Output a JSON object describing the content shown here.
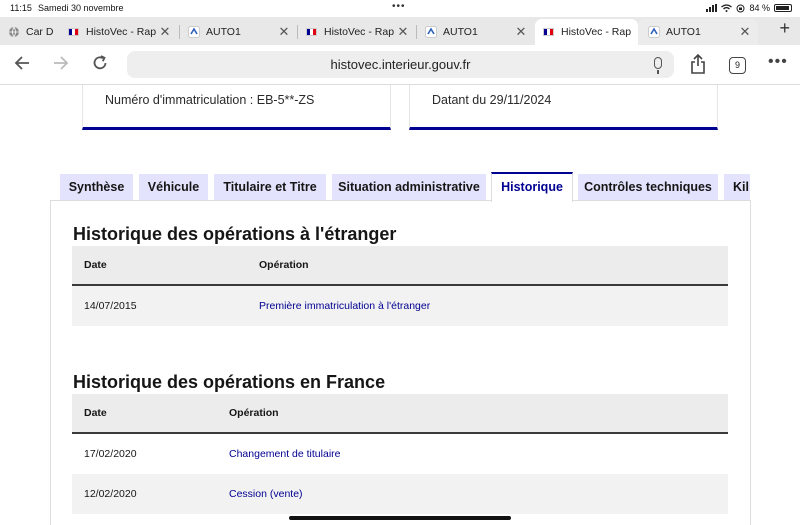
{
  "status": {
    "time": "11:15",
    "date": "Samedi 30 novembre",
    "battery": "84 %"
  },
  "browser_tabs": [
    {
      "title": "Car D",
      "favicon": "globe-icon",
      "closable": false
    },
    {
      "title": "HistoVec - Rap",
      "favicon": "french-flag-icon",
      "closable": true
    },
    {
      "title": "AUTO1",
      "favicon": "auto1-icon",
      "closable": true
    },
    {
      "title": "HistoVec - Rap",
      "favicon": "french-flag-icon",
      "closable": true
    },
    {
      "title": "AUTO1",
      "favicon": "auto1-icon",
      "closable": true
    },
    {
      "title": "HistoVec - Rap",
      "favicon": "french-flag-icon",
      "closable": false,
      "active": true
    },
    {
      "title": "AUTO1",
      "favicon": "auto1-icon",
      "closable": true
    }
  ],
  "address": {
    "url": "histovec.interieur.gouv.fr",
    "tab_count": "9"
  },
  "cards": {
    "left": "Numéro d'immatriculation : EB-5**-ZS",
    "right": "Datant du 29/11/2024"
  },
  "page_tabs": [
    {
      "label": "Synthèse"
    },
    {
      "label": "Véhicule"
    },
    {
      "label": "Titulaire et Titre"
    },
    {
      "label": "Situation administrative"
    },
    {
      "label": "Historique",
      "active": true
    },
    {
      "label": "Contrôles techniques"
    },
    {
      "label": "Kil"
    }
  ],
  "foreign": {
    "title": "Historique des opérations à l'étranger",
    "headers": [
      "Date",
      "Opération"
    ],
    "rows": [
      {
        "date": "14/07/2015",
        "operation": "Première immatriculation à l'étranger"
      }
    ]
  },
  "france": {
    "title": "Historique des opérations en France",
    "headers": [
      "Date",
      "Opération"
    ],
    "rows": [
      {
        "date": "17/02/2020",
        "operation": "Changement de titulaire"
      },
      {
        "date": "12/02/2020",
        "operation": "Cession (vente)"
      }
    ]
  },
  "colors": {
    "accent": "#000091",
    "tab_bg": "#e3e3fd"
  }
}
